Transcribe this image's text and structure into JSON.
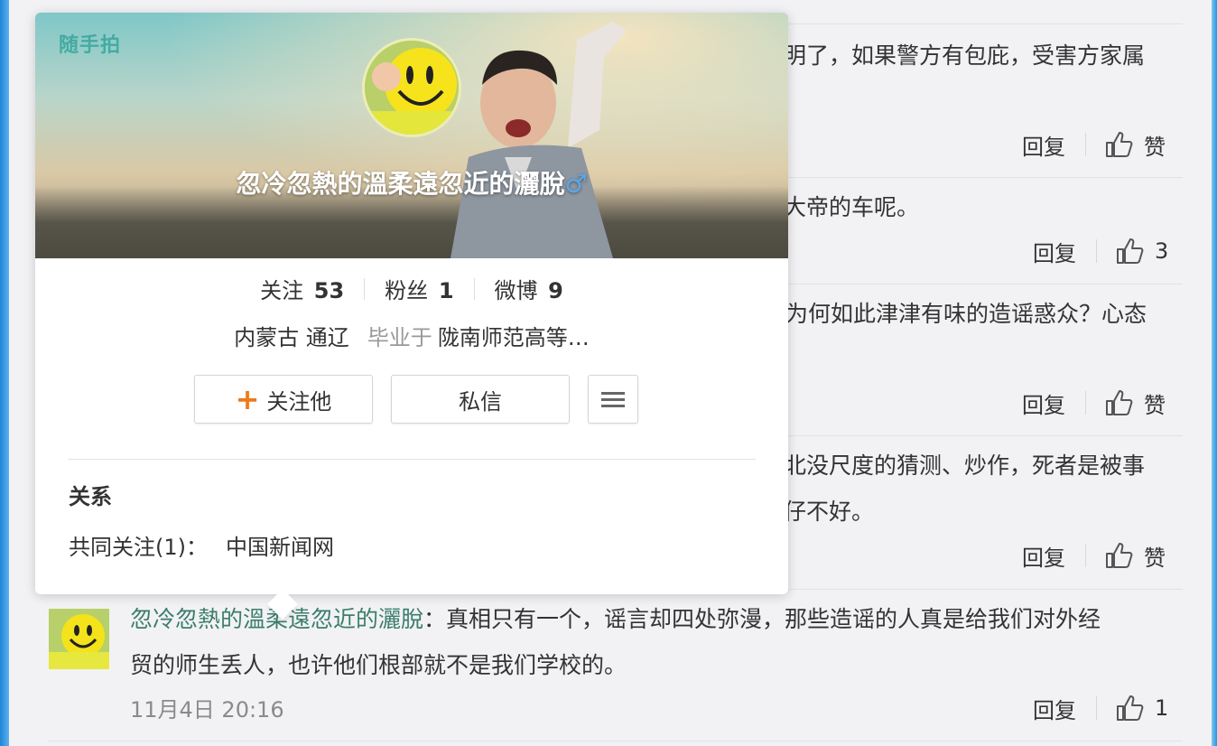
{
  "comments": [
    {
      "text_lines": [
        "明了，如果警方有包庇，受害方家属"
      ],
      "reply": "回复",
      "like": "赞"
    },
    {
      "text_lines": [
        "大帝的车呢。"
      ],
      "reply": "回复",
      "like": "3"
    },
    {
      "text_lines": [
        "为何如此津津有味的造谣惑众？心态"
      ],
      "reply": "回复",
      "like": "赞"
    },
    {
      "text_lines": [
        "北没尺度的猜测、炒作，死者是被事",
        "仔不好。"
      ],
      "reply": "回复",
      "like": "赞"
    }
  ],
  "last_comment": {
    "author": "忽冷忽熱的溫柔遠忽近的灑脫",
    "colon": "：",
    "line1": "真相只有一个，谣言却四处弥漫，那些造谣的人真是给我们对外经",
    "line2": "贸的师生丢人，也许他们根部就不是我们学校的。",
    "time": "11月4日 20:16",
    "reply": "回复",
    "like": "1"
  },
  "card": {
    "cover_logo": "随手拍",
    "name": "忽冷忽熱的溫柔遠忽近的灑脫",
    "gender": "♂",
    "stats": [
      {
        "label": "关注",
        "value": "53"
      },
      {
        "label": "粉丝",
        "value": "1"
      },
      {
        "label": "微博",
        "value": "9"
      }
    ],
    "location": "内蒙古 通辽",
    "edu_prefix": "毕业于",
    "edu": "陇南师范高等…",
    "follow_btn": "关注他",
    "message_btn": "私信",
    "relation_title": "关系",
    "common_label": "共同关注(1)：",
    "common_value": "中国新闻网"
  },
  "colors": {
    "accent_orange": "#f07a1a",
    "name_link": "#3b7e6a",
    "gender_blue": "#5aa7e8"
  }
}
